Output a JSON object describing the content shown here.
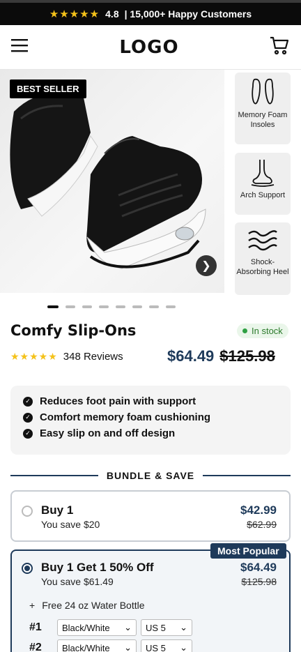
{
  "announcement": {
    "rating": "4.8",
    "text": "| 15,000+ Happy Customers"
  },
  "header": {
    "logo": "LOGO"
  },
  "gallery": {
    "badge": "BEST SELLER",
    "features": [
      {
        "icon": "insoles-icon",
        "label": "Memory Foam Insoles"
      },
      {
        "icon": "arch-support-icon",
        "label": "Arch Support"
      },
      {
        "icon": "waves-icon",
        "label": "Shock-Absorbing Heel"
      }
    ],
    "slide_count": 8,
    "active_slide": 1
  },
  "product": {
    "title": "Comfy Slip-Ons",
    "stock": "In stock",
    "reviews": "348 Reviews",
    "price": "$64.49",
    "compare_price": "$125.98"
  },
  "benefits": [
    "Reduces foot pain with support",
    "Comfort memory foam cushioning",
    "Easy slip on and off design"
  ],
  "bundle": {
    "heading": "BUNDLE & SAVE",
    "options": [
      {
        "title": "Buy 1",
        "save": "You save $20",
        "price": "$42.99",
        "was": "$62.99",
        "selected": false
      },
      {
        "title": "Buy 1 Get 1 50% Off",
        "save": "You save $61.49",
        "price": "$64.49",
        "was": "$125.98",
        "selected": true,
        "badge": "Most Popular",
        "gift": "Free 24 oz Water Bottle",
        "rows": [
          {
            "num": "#1",
            "color": "Black/White",
            "size": "US 5"
          },
          {
            "num": "#2",
            "color": "Black/White",
            "size": "US 5"
          }
        ]
      }
    ]
  },
  "colors": {
    "accent": "#1e3a5a",
    "star": "#f4c21a",
    "stock_green": "#2ea043"
  }
}
